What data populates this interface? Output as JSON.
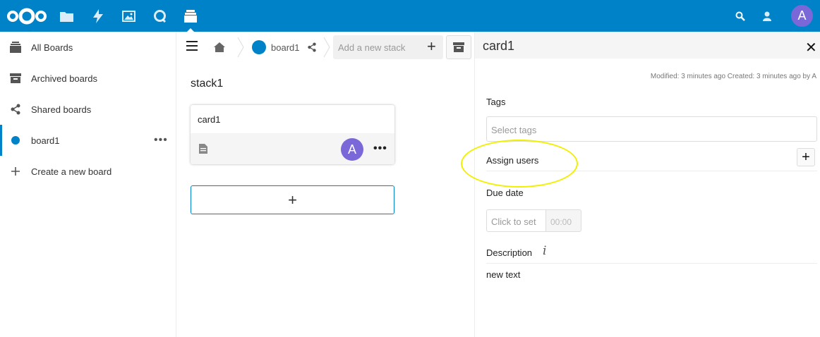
{
  "topbar": {
    "logo_icon": "nextcloud-logo",
    "apps": [
      "files-icon",
      "activity-icon",
      "photos-icon",
      "talk-icon",
      "deck-icon"
    ],
    "search_icon": "search-icon",
    "contacts_icon": "contacts-icon",
    "avatar_initial": "A",
    "bg_color": "#0082c9"
  },
  "sidebar": {
    "items": [
      {
        "label": "All Boards",
        "icon": "boards-icon"
      },
      {
        "label": "Archived boards",
        "icon": "archive-icon"
      },
      {
        "label": "Shared boards",
        "icon": "share-icon"
      },
      {
        "label": "board1",
        "icon": "board-color-dot",
        "more": "•••"
      },
      {
        "label": "Create a new board",
        "icon": "plus-icon"
      }
    ]
  },
  "board": {
    "name": "board1",
    "add_stack_placeholder": "Add a new stack",
    "add_stack_plus": "+",
    "stack": {
      "title": "stack1",
      "card": {
        "title": "card1",
        "avatar_initial": "A",
        "more": "•••"
      },
      "add_card": "+"
    }
  },
  "details": {
    "title": "card1",
    "close": "✕",
    "meta": "Modified: 3 minutes ago Created: 3 minutes ago by A",
    "tags_label": "Tags",
    "tags_placeholder": "Select tags",
    "assign_label": "Assign users",
    "assign_plus": "+",
    "due_label": "Due date",
    "due_placeholder": "Click to set",
    "due_time_placeholder": "00:00",
    "description_label": "Description",
    "description_info": "i",
    "description_text": "new text"
  }
}
